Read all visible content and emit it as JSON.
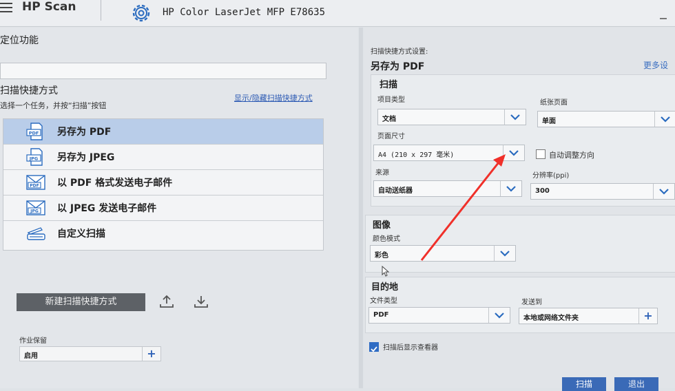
{
  "app": {
    "name": "HP Scan",
    "printer": "HP Color LaserJet MFP E78635"
  },
  "left": {
    "locate_heading": "定位功能",
    "shortcuts_heading": "扫描快捷方式",
    "shortcuts_sub": "选择一个任务，并按“扫描”按钮",
    "toggle_link": "显示/隐藏扫描快捷方式",
    "shortcuts": [
      {
        "label": "另存为 PDF",
        "icon": "pdf-file-icon",
        "selected": true
      },
      {
        "label": "另存为 JPEG",
        "icon": "jpg-file-icon",
        "selected": false
      },
      {
        "label": "以 PDF 格式发送电子邮件",
        "icon": "pdf-email-icon",
        "selected": false
      },
      {
        "label": "以 JPEG 发送电子邮件",
        "icon": "jpg-email-icon",
        "selected": false
      },
      {
        "label": "自定义扫描",
        "icon": "scanner-icon",
        "selected": false
      }
    ],
    "icon_tags": {
      "pdf": "PDF",
      "jpg": "JPG"
    },
    "new_shortcut_button": "新建扫描快捷方式",
    "job_storage_label": "作业保留",
    "job_storage_value": "启用"
  },
  "right": {
    "settings_label": "扫描快捷方式设置:",
    "settings_name": "另存为 PDF",
    "more_settings": "更多设",
    "scan": {
      "title": "扫描",
      "item_type_label": "项目类型",
      "item_type_value": "文档",
      "paper_side_label": "纸张页面",
      "paper_side_value": "单面",
      "page_size_label": "页面尺寸",
      "page_size_value": "A4 (210 x 297 毫米)",
      "auto_orient_label": "自动调整方向",
      "auto_orient_checked": false,
      "source_label": "来源",
      "source_value": "自动送纸器",
      "resolution_label": "分辨率(ppi)",
      "resolution_value": "300"
    },
    "image": {
      "title": "图像",
      "color_mode_label": "颜色模式",
      "color_mode_value": "彩色"
    },
    "destination": {
      "title": "目的地",
      "file_type_label": "文件类型",
      "file_type_value": "PDF",
      "send_to_label": "发送到",
      "send_to_value": "本地或网络文件夹"
    },
    "show_viewer_label": "扫描后显示查看器",
    "show_viewer_checked": true
  },
  "footer": {
    "scan_button": "扫描",
    "exit_button": "退出"
  },
  "colors": {
    "accent": "#2f6cc4",
    "selected_row": "#b9cde9",
    "annotation_arrow": "#f0302a"
  }
}
